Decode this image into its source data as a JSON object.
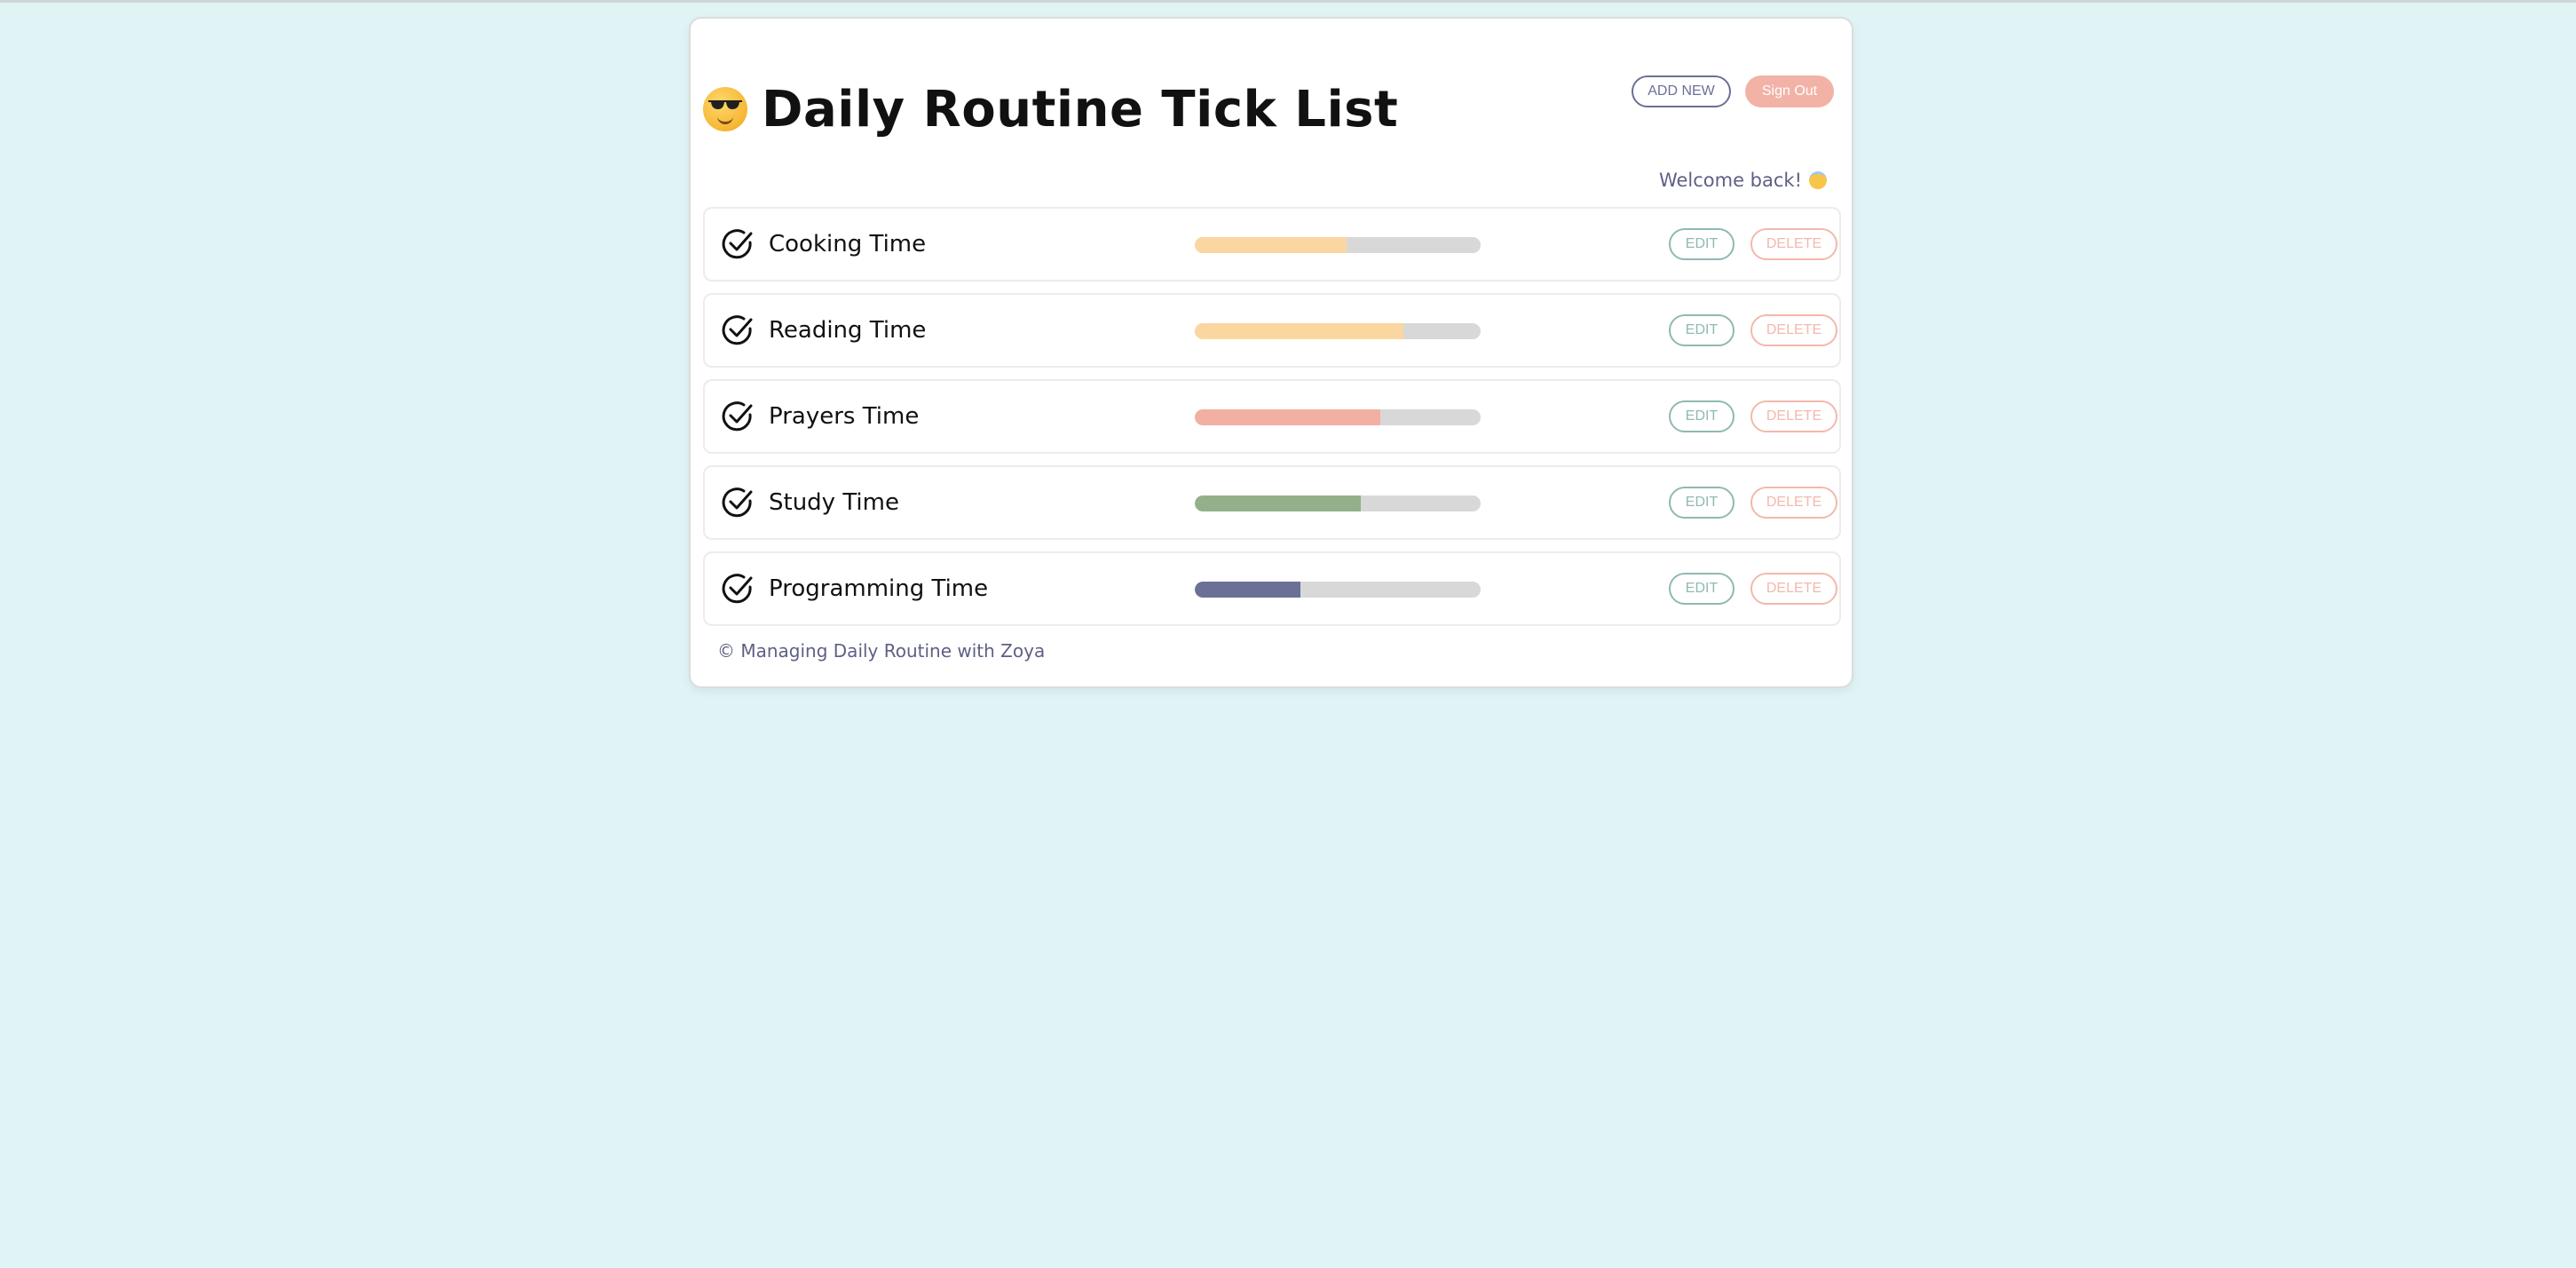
{
  "app": {
    "title": "Daily Routine Tick List",
    "title_emoji_icon": "smiling-face-with-sunglasses-icon"
  },
  "header": {
    "add_new_label": "ADD NEW",
    "sign_out_label": "Sign Out"
  },
  "welcome": {
    "text": "Welcome back!",
    "emoji_icon": "smiling-face-with-halo-icon"
  },
  "routines": [
    {
      "label": "Cooking Time",
      "progress": 0.53,
      "color": "#fad7a0"
    },
    {
      "label": "Reading Time",
      "progress": 0.73,
      "color": "#fad7a0"
    },
    {
      "label": "Prayers Time",
      "progress": 0.65,
      "color": "#f2b0a2"
    },
    {
      "label": "Study Time",
      "progress": 0.58,
      "color": "#93b08b"
    },
    {
      "label": "Programming Time",
      "progress": 0.37,
      "color": "#6b7097"
    }
  ],
  "actions": {
    "edit_label": "EDIT",
    "delete_label": "DELETE"
  },
  "footer": {
    "text": "© Managing Daily Routine with Zoya"
  },
  "colors": {
    "page_background": "#e0f3f5",
    "accent_navy": "#6b7097",
    "accent_salmon": "#f3b2a6",
    "accent_teal": "#8fb9b3",
    "track_gray": "#d8d8d8"
  }
}
